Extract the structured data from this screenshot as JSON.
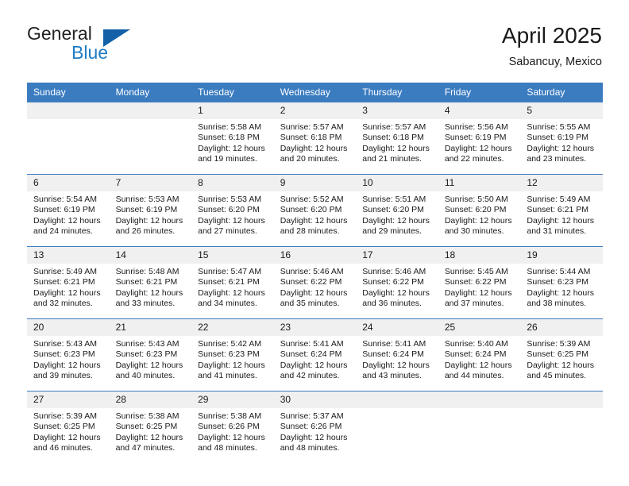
{
  "brand": {
    "word_one": "General",
    "word_two": "Blue",
    "triangle_icon": "blue-triangle-logo"
  },
  "header": {
    "title": "April 2025",
    "subtitle": "Sabancuy, Mexico"
  },
  "colors": {
    "header_blue": "#3b7cc0",
    "brand_blue": "#1f7bc4",
    "daynum_band": "#f0f0f0"
  },
  "labels": {
    "sunrise_prefix": "Sunrise:",
    "sunset_prefix": "Sunset:",
    "daylight_prefix": "Daylight:"
  },
  "weekdays": [
    "Sunday",
    "Monday",
    "Tuesday",
    "Wednesday",
    "Thursday",
    "Friday",
    "Saturday"
  ],
  "weeks": [
    [
      {
        "day": "",
        "empty": true,
        "sunrise": "",
        "sunset": "",
        "daylight": ""
      },
      {
        "day": "",
        "empty": true,
        "sunrise": "",
        "sunset": "",
        "daylight": ""
      },
      {
        "day": "1",
        "sunrise": "Sunrise: 5:58 AM",
        "sunset": "Sunset: 6:18 PM",
        "daylight": "Daylight: 12 hours and 19 minutes."
      },
      {
        "day": "2",
        "sunrise": "Sunrise: 5:57 AM",
        "sunset": "Sunset: 6:18 PM",
        "daylight": "Daylight: 12 hours and 20 minutes."
      },
      {
        "day": "3",
        "sunrise": "Sunrise: 5:57 AM",
        "sunset": "Sunset: 6:18 PM",
        "daylight": "Daylight: 12 hours and 21 minutes."
      },
      {
        "day": "4",
        "sunrise": "Sunrise: 5:56 AM",
        "sunset": "Sunset: 6:19 PM",
        "daylight": "Daylight: 12 hours and 22 minutes."
      },
      {
        "day": "5",
        "sunrise": "Sunrise: 5:55 AM",
        "sunset": "Sunset: 6:19 PM",
        "daylight": "Daylight: 12 hours and 23 minutes."
      }
    ],
    [
      {
        "day": "6",
        "sunrise": "Sunrise: 5:54 AM",
        "sunset": "Sunset: 6:19 PM",
        "daylight": "Daylight: 12 hours and 24 minutes."
      },
      {
        "day": "7",
        "sunrise": "Sunrise: 5:53 AM",
        "sunset": "Sunset: 6:19 PM",
        "daylight": "Daylight: 12 hours and 26 minutes."
      },
      {
        "day": "8",
        "sunrise": "Sunrise: 5:53 AM",
        "sunset": "Sunset: 6:20 PM",
        "daylight": "Daylight: 12 hours and 27 minutes."
      },
      {
        "day": "9",
        "sunrise": "Sunrise: 5:52 AM",
        "sunset": "Sunset: 6:20 PM",
        "daylight": "Daylight: 12 hours and 28 minutes."
      },
      {
        "day": "10",
        "sunrise": "Sunrise: 5:51 AM",
        "sunset": "Sunset: 6:20 PM",
        "daylight": "Daylight: 12 hours and 29 minutes."
      },
      {
        "day": "11",
        "sunrise": "Sunrise: 5:50 AM",
        "sunset": "Sunset: 6:20 PM",
        "daylight": "Daylight: 12 hours and 30 minutes."
      },
      {
        "day": "12",
        "sunrise": "Sunrise: 5:49 AM",
        "sunset": "Sunset: 6:21 PM",
        "daylight": "Daylight: 12 hours and 31 minutes."
      }
    ],
    [
      {
        "day": "13",
        "sunrise": "Sunrise: 5:49 AM",
        "sunset": "Sunset: 6:21 PM",
        "daylight": "Daylight: 12 hours and 32 minutes."
      },
      {
        "day": "14",
        "sunrise": "Sunrise: 5:48 AM",
        "sunset": "Sunset: 6:21 PM",
        "daylight": "Daylight: 12 hours and 33 minutes."
      },
      {
        "day": "15",
        "sunrise": "Sunrise: 5:47 AM",
        "sunset": "Sunset: 6:21 PM",
        "daylight": "Daylight: 12 hours and 34 minutes."
      },
      {
        "day": "16",
        "sunrise": "Sunrise: 5:46 AM",
        "sunset": "Sunset: 6:22 PM",
        "daylight": "Daylight: 12 hours and 35 minutes."
      },
      {
        "day": "17",
        "sunrise": "Sunrise: 5:46 AM",
        "sunset": "Sunset: 6:22 PM",
        "daylight": "Daylight: 12 hours and 36 minutes."
      },
      {
        "day": "18",
        "sunrise": "Sunrise: 5:45 AM",
        "sunset": "Sunset: 6:22 PM",
        "daylight": "Daylight: 12 hours and 37 minutes."
      },
      {
        "day": "19",
        "sunrise": "Sunrise: 5:44 AM",
        "sunset": "Sunset: 6:23 PM",
        "daylight": "Daylight: 12 hours and 38 minutes."
      }
    ],
    [
      {
        "day": "20",
        "sunrise": "Sunrise: 5:43 AM",
        "sunset": "Sunset: 6:23 PM",
        "daylight": "Daylight: 12 hours and 39 minutes."
      },
      {
        "day": "21",
        "sunrise": "Sunrise: 5:43 AM",
        "sunset": "Sunset: 6:23 PM",
        "daylight": "Daylight: 12 hours and 40 minutes."
      },
      {
        "day": "22",
        "sunrise": "Sunrise: 5:42 AM",
        "sunset": "Sunset: 6:23 PM",
        "daylight": "Daylight: 12 hours and 41 minutes."
      },
      {
        "day": "23",
        "sunrise": "Sunrise: 5:41 AM",
        "sunset": "Sunset: 6:24 PM",
        "daylight": "Daylight: 12 hours and 42 minutes."
      },
      {
        "day": "24",
        "sunrise": "Sunrise: 5:41 AM",
        "sunset": "Sunset: 6:24 PM",
        "daylight": "Daylight: 12 hours and 43 minutes."
      },
      {
        "day": "25",
        "sunrise": "Sunrise: 5:40 AM",
        "sunset": "Sunset: 6:24 PM",
        "daylight": "Daylight: 12 hours and 44 minutes."
      },
      {
        "day": "26",
        "sunrise": "Sunrise: 5:39 AM",
        "sunset": "Sunset: 6:25 PM",
        "daylight": "Daylight: 12 hours and 45 minutes."
      }
    ],
    [
      {
        "day": "27",
        "sunrise": "Sunrise: 5:39 AM",
        "sunset": "Sunset: 6:25 PM",
        "daylight": "Daylight: 12 hours and 46 minutes."
      },
      {
        "day": "28",
        "sunrise": "Sunrise: 5:38 AM",
        "sunset": "Sunset: 6:25 PM",
        "daylight": "Daylight: 12 hours and 47 minutes."
      },
      {
        "day": "29",
        "sunrise": "Sunrise: 5:38 AM",
        "sunset": "Sunset: 6:26 PM",
        "daylight": "Daylight: 12 hours and 48 minutes."
      },
      {
        "day": "30",
        "sunrise": "Sunrise: 5:37 AM",
        "sunset": "Sunset: 6:26 PM",
        "daylight": "Daylight: 12 hours and 48 minutes."
      },
      {
        "day": "",
        "empty": true,
        "sunrise": "",
        "sunset": "",
        "daylight": ""
      },
      {
        "day": "",
        "empty": true,
        "sunrise": "",
        "sunset": "",
        "daylight": ""
      },
      {
        "day": "",
        "empty": true,
        "sunrise": "",
        "sunset": "",
        "daylight": ""
      }
    ]
  ]
}
